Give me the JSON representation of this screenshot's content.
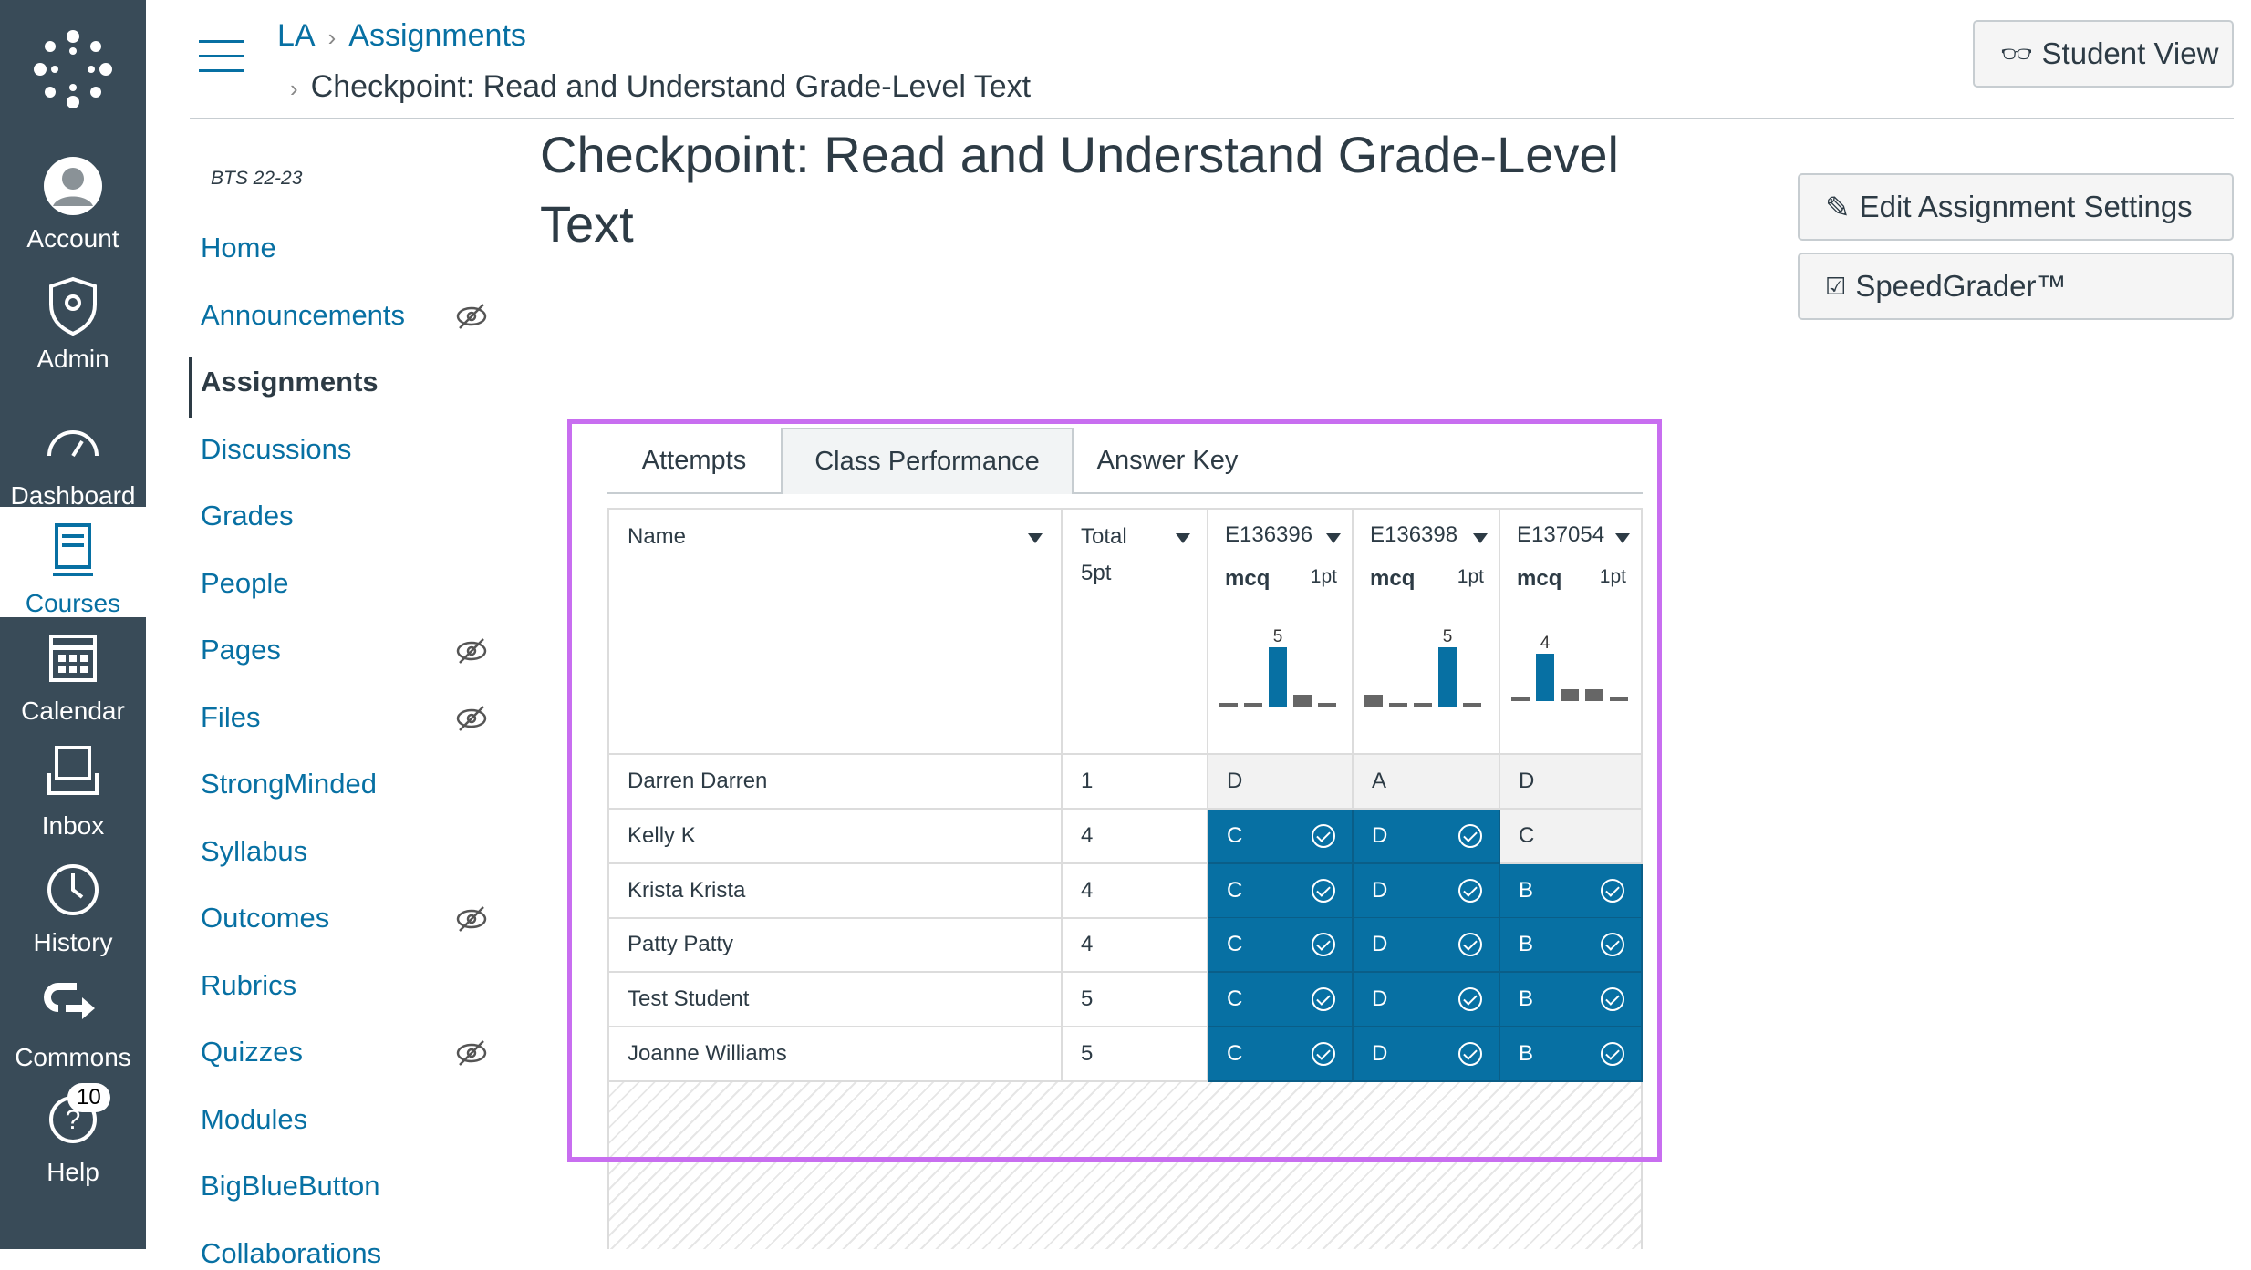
{
  "global_nav": [
    {
      "label": "Account",
      "icon": "account-icon"
    },
    {
      "label": "Admin",
      "icon": "admin-shield-icon"
    },
    {
      "label": "Dashboard",
      "icon": "dashboard-icon"
    },
    {
      "label": "Courses",
      "icon": "courses-icon",
      "active": true
    },
    {
      "label": "Calendar",
      "icon": "calendar-icon"
    },
    {
      "label": "Inbox",
      "icon": "inbox-icon"
    },
    {
      "label": "History",
      "icon": "history-icon"
    },
    {
      "label": "Commons",
      "icon": "commons-icon"
    },
    {
      "label": "Help",
      "icon": "help-icon",
      "badge": "10"
    }
  ],
  "breadcrumb": {
    "course": "LA",
    "section": "Assignments",
    "current": "Checkpoint: Read and Understand Grade-Level Text"
  },
  "student_view_label": "Student View",
  "term": "BTS 22-23",
  "course_nav": [
    {
      "label": "Home"
    },
    {
      "label": "Announcements",
      "hidden": true
    },
    {
      "label": "Assignments",
      "active": true
    },
    {
      "label": "Discussions"
    },
    {
      "label": "Grades"
    },
    {
      "label": "People"
    },
    {
      "label": "Pages",
      "hidden": true
    },
    {
      "label": "Files",
      "hidden": true
    },
    {
      "label": "StrongMinded"
    },
    {
      "label": "Syllabus"
    },
    {
      "label": "Outcomes",
      "hidden": true
    },
    {
      "label": "Rubrics"
    },
    {
      "label": "Quizzes",
      "hidden": true
    },
    {
      "label": "Modules"
    },
    {
      "label": "BigBlueButton"
    },
    {
      "label": "Collaborations"
    }
  ],
  "title_line1": "Checkpoint: Read and Understand Grade-Level",
  "title_line2": "Text",
  "edit_settings_label": "Edit Assignment Settings",
  "speedgrader_label": "SpeedGrader™",
  "tabs": [
    {
      "label": "Attempts"
    },
    {
      "label": "Class Performance",
      "active": true
    },
    {
      "label": "Answer Key"
    }
  ],
  "table": {
    "name_header": "Name",
    "total_header": "Total",
    "total_points": "5pt",
    "questions": [
      {
        "id": "E136396",
        "type": "mcq",
        "points": "1pt",
        "histogram": [
          0,
          0,
          5,
          1,
          0
        ],
        "correct_index": 2,
        "label": "5"
      },
      {
        "id": "E136398",
        "type": "mcq",
        "points": "1pt",
        "histogram": [
          1,
          0,
          0,
          5,
          0
        ],
        "correct_index": 3,
        "label": "5"
      },
      {
        "id": "E137054",
        "type": "mcq",
        "points": "1pt",
        "histogram": [
          0,
          4,
          1,
          1,
          0
        ],
        "correct_index": 1,
        "label": "4"
      }
    ],
    "rows": [
      {
        "name": "Darren Darren",
        "total": "1",
        "answers": [
          {
            "a": "D",
            "ok": false
          },
          {
            "a": "A",
            "ok": false
          },
          {
            "a": "D",
            "ok": false
          }
        ]
      },
      {
        "name": "Kelly K",
        "total": "4",
        "answers": [
          {
            "a": "C",
            "ok": true
          },
          {
            "a": "D",
            "ok": true
          },
          {
            "a": "C",
            "ok": false
          }
        ]
      },
      {
        "name": "Krista Krista",
        "total": "4",
        "answers": [
          {
            "a": "C",
            "ok": true
          },
          {
            "a": "D",
            "ok": true
          },
          {
            "a": "B",
            "ok": true
          }
        ]
      },
      {
        "name": "Patty Patty",
        "total": "4",
        "answers": [
          {
            "a": "C",
            "ok": true
          },
          {
            "a": "D",
            "ok": true
          },
          {
            "a": "B",
            "ok": true
          }
        ]
      },
      {
        "name": "Test Student",
        "total": "5",
        "answers": [
          {
            "a": "C",
            "ok": true
          },
          {
            "a": "D",
            "ok": true
          },
          {
            "a": "B",
            "ok": true
          }
        ]
      },
      {
        "name": "Joanne Williams",
        "total": "5",
        "answers": [
          {
            "a": "C",
            "ok": true
          },
          {
            "a": "D",
            "ok": true
          },
          {
            "a": "B",
            "ok": true
          }
        ]
      }
    ]
  },
  "colors": {
    "nav_bg": "#394b58",
    "link": "#0770a3",
    "correct": "#0770a3",
    "bar_other": "#666666",
    "highlight": "#c86ef0"
  }
}
